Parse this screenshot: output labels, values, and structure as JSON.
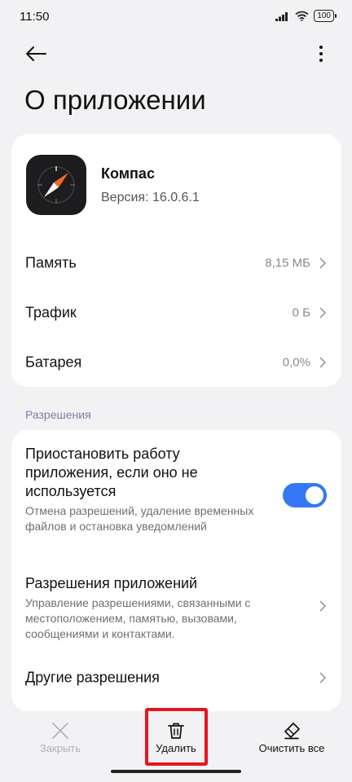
{
  "status": {
    "time": "11:50",
    "battery": "100"
  },
  "page": {
    "title": "О приложении"
  },
  "app": {
    "name": "Компас",
    "version": "Версия: 16.0.6.1"
  },
  "info_rows": [
    {
      "label": "Память",
      "value": "8,15 МБ"
    },
    {
      "label": "Трафик",
      "value": "0 Б"
    },
    {
      "label": "Батарея",
      "value": "0,0%"
    }
  ],
  "permissions": {
    "section_label": "Разрешения",
    "pause": {
      "title": "Приостановить работу приложения, если оно не используется",
      "desc": "Отмена разрешений, удаление временных файлов и остановка уведомлений",
      "enabled": true
    },
    "app_perms": {
      "title": "Разрешения приложений",
      "desc": "Управление разрешениями, связанными с местоположением, памятью, вызовами, сообщениями и контактами."
    },
    "other": {
      "title": "Другие разрешения"
    }
  },
  "bottom": {
    "close_label": "Закрыть",
    "delete_label": "Удалить",
    "clear_label": "Очистить все"
  },
  "colors": {
    "accent": "#3478f6",
    "highlight": "#e8141d",
    "compass_needle": "#f26a2e"
  }
}
